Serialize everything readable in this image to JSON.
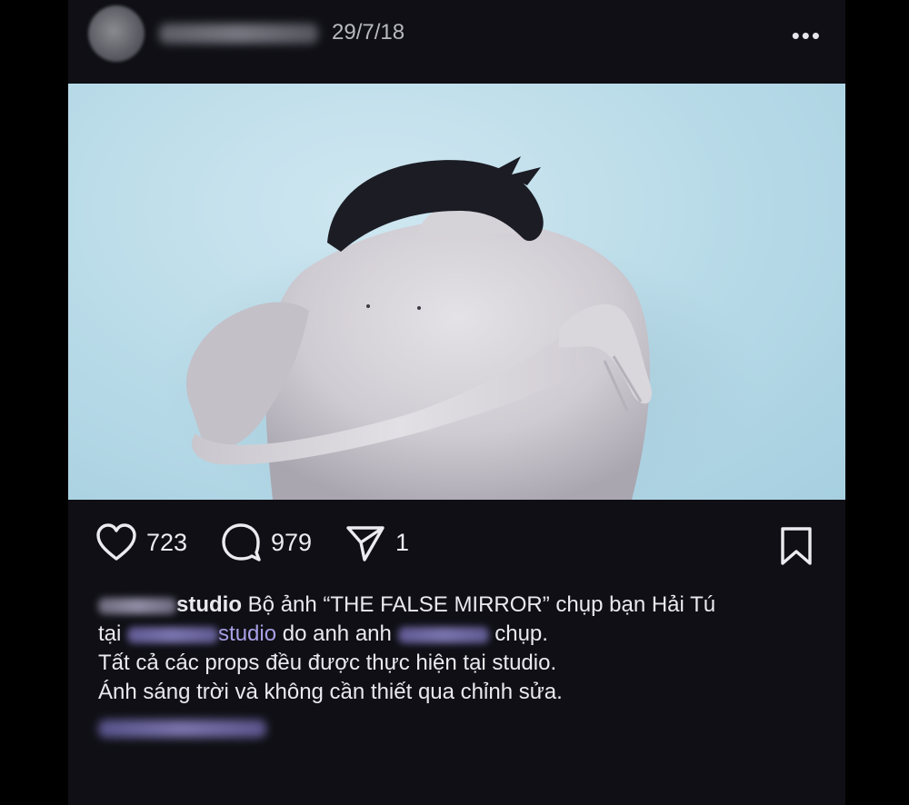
{
  "post": {
    "date": "29/7/18",
    "more_icon": "more-dots-icon",
    "likes": "723",
    "comments": "979",
    "shares": "1",
    "icons": [
      "heart-icon",
      "comment-icon",
      "share-icon",
      "bookmark-icon"
    ]
  },
  "caption": {
    "username_suffix": "studio",
    "line1_text": "Bộ ảnh “THE FALSE MIRROR” chụp bạn Hải Tú",
    "line2_prefix": "tại",
    "line2_mention_suffix": "studio",
    "line2_mid": "do anh anh",
    "line2_end": "chụp.",
    "line3": "Tất cả các props đều được thực hiện tại studio.",
    "line4": "Ánh sáng trời và không cần thiết qua chỉnh sửa."
  },
  "colors": {
    "background": "#0f0f15",
    "mention": "#a9a0e6",
    "photo_wall": "#b9dbe8"
  }
}
